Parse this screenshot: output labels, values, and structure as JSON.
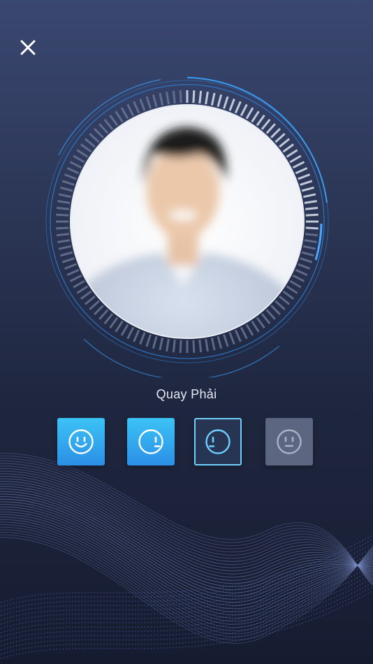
{
  "screen": {
    "instruction": "Quay Phải"
  },
  "icons": {
    "close": "close-icon",
    "face_front": "smile-face-icon",
    "face_right": "face-turn-right-icon",
    "face_left": "face-turn-left-icon",
    "face_neutral": "neutral-face-icon"
  },
  "steps": [
    {
      "id": "front",
      "state": "done"
    },
    {
      "id": "turn-right",
      "state": "done"
    },
    {
      "id": "turn-left",
      "state": "active"
    },
    {
      "id": "neutral",
      "state": "pending"
    }
  ],
  "colors": {
    "accent": "#2e8fe6",
    "accent_light": "#6fd0ff",
    "background_top": "#3a4770",
    "background_bottom": "#161c30",
    "pending": "#5c6680"
  }
}
